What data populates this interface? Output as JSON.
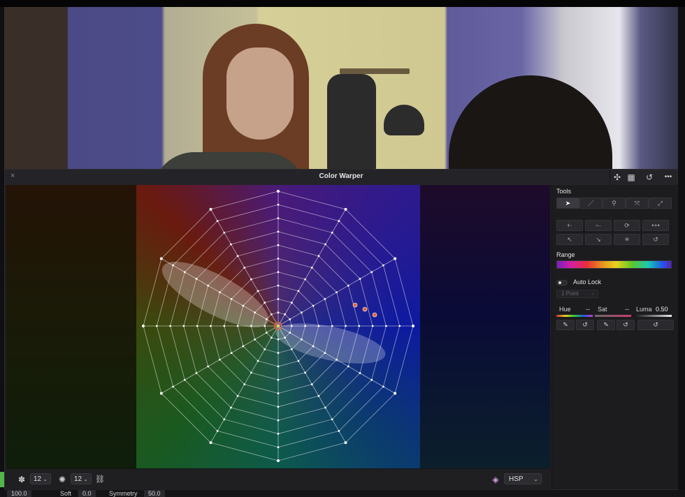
{
  "panel": {
    "title": "Color Warper",
    "close_icon": "×"
  },
  "header_icons": [
    {
      "name": "color-wheel-grid-icon",
      "glyph": "✣"
    },
    {
      "name": "grid-view-icon",
      "glyph": "▦"
    },
    {
      "name": "reset-icon",
      "glyph": "↺"
    },
    {
      "name": "more-options-icon",
      "glyph": "•••"
    }
  ],
  "warper_toolbar": {
    "hue_wheel_icon": "✽",
    "hue_points_value": "12",
    "sat_wheel_icon": "✺",
    "sat_points_value": "12",
    "link_icon": "⛓",
    "colorspace_icon": "◈",
    "colorspace_value": "HSP"
  },
  "side": {
    "tools_label": "Tools",
    "tools_row1": [
      {
        "name": "select-tool-button",
        "glyph": "➤",
        "active": true
      },
      {
        "name": "brush-tool-button",
        "glyph": "／",
        "active": false
      },
      {
        "name": "pin-tool-button",
        "glyph": "⚲",
        "active": false
      },
      {
        "name": "expand-tool-button",
        "glyph": "⤧",
        "active": false
      },
      {
        "name": "fit-tool-button",
        "glyph": "⤢",
        "active": false
      }
    ],
    "tools_row2": [
      {
        "name": "add-point-button",
        "glyph": "+·"
      },
      {
        "name": "remove-point-button",
        "glyph": "−·"
      },
      {
        "name": "lock-point-button",
        "glyph": "⟳"
      },
      {
        "name": "distribute-points-button",
        "glyph": "•+•"
      }
    ],
    "tools_row3": [
      {
        "name": "pick-point-button",
        "glyph": "↖"
      },
      {
        "name": "pick-dot-button",
        "glyph": "↘"
      },
      {
        "name": "center-point-button",
        "glyph": "✳"
      },
      {
        "name": "reset-points-button",
        "glyph": "↺"
      }
    ],
    "range_label": "Range",
    "auto_lock_label": "Auto Lock",
    "point_select_value": "1 Point",
    "hue_label": "Hue",
    "hue_value": "--",
    "sat_label": "Sat",
    "sat_value": "--",
    "luma_label": "Luma",
    "luma_value": "0.50"
  },
  "bottom_strip": {
    "left_value": "100.0",
    "soft_label": "Soft",
    "soft_value": "0.0",
    "symmetry_label": "Symmetry",
    "symmetry_value": "50.0"
  },
  "colors": {
    "accent_orange": "#e0663a",
    "panel_bg": "#1f1f22"
  }
}
